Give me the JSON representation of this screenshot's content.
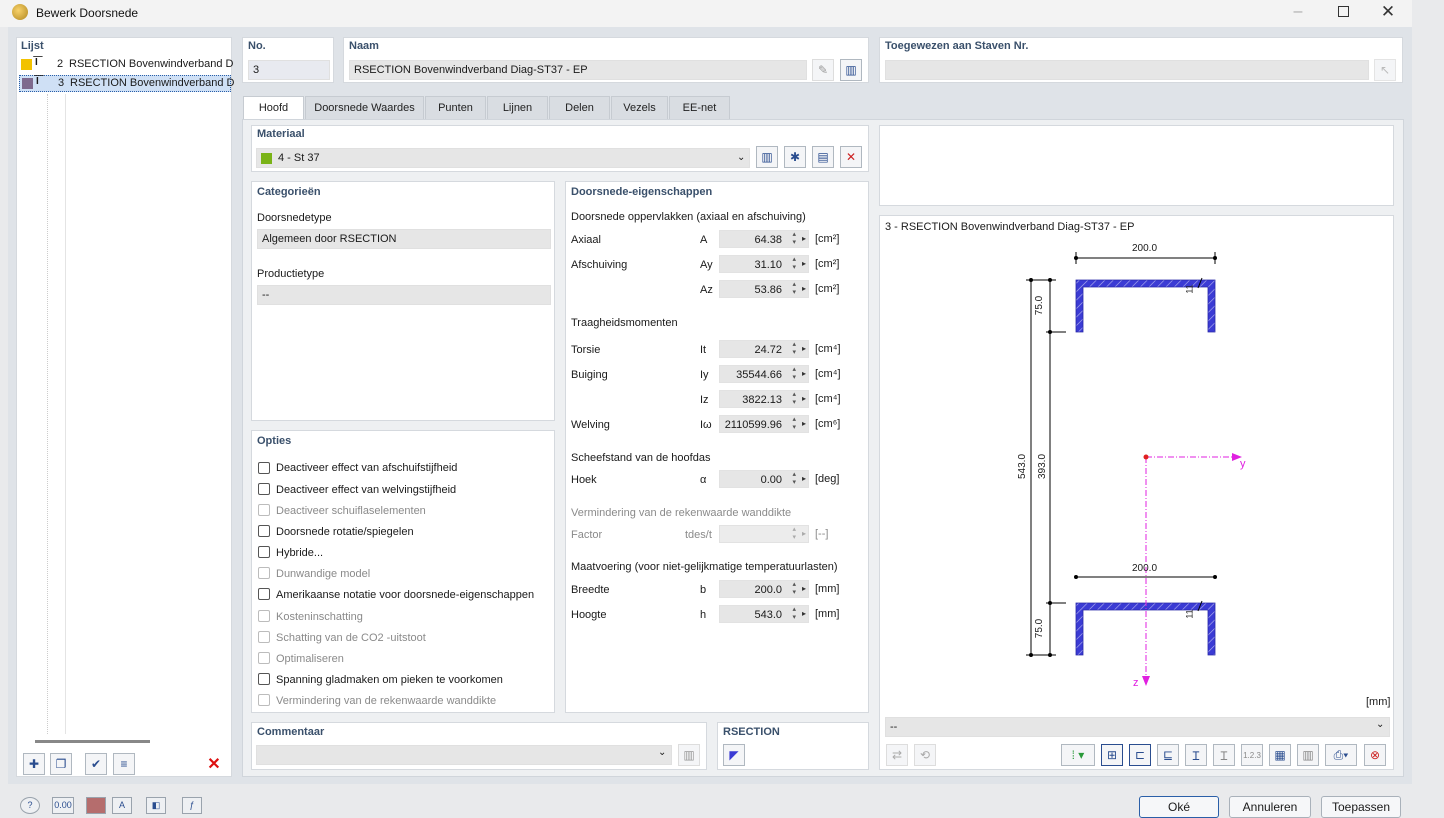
{
  "window": {
    "title": "Bewerk Doorsnede",
    "minimize_icon": "minimize-icon",
    "maximize_icon": "maximize-icon",
    "close_icon": "close-icon"
  },
  "list": {
    "header": "Lijst",
    "items": [
      {
        "no": "2",
        "label": "RSECTION Bovenwindverband D",
        "color": "#f2c200"
      },
      {
        "no": "3",
        "label": "RSECTION Bovenwindverband D",
        "color": "#7e6a8e"
      }
    ]
  },
  "no": {
    "header": "No.",
    "value": "3"
  },
  "naam": {
    "header": "Naam",
    "value": "RSECTION Bovenwindverband Diag-ST37 - EP"
  },
  "toegewezen": {
    "header": "Toegewezen aan Staven Nr.",
    "value": ""
  },
  "tabs": [
    "Hoofd",
    "Doorsnede Waardes",
    "Punten",
    "Lijnen",
    "Delen",
    "Vezels",
    "EE-net"
  ],
  "materiaal": {
    "header": "Materiaal",
    "value": "4 - St 37",
    "color": "#7ab317"
  },
  "categorieen": {
    "header": "Categorieën",
    "type_label": "Doorsnedetype",
    "type_value": "Algemeen door RSECTION",
    "product_label": "Productietype",
    "product_value": "--"
  },
  "opties": {
    "header": "Opties",
    "items": [
      {
        "label": "Deactiveer effect van afschuifstijfheid",
        "enabled": true
      },
      {
        "label": "Deactiveer effect van welvingstijfheid",
        "enabled": true
      },
      {
        "label": "Deactiveer schuiflaselementen",
        "enabled": false
      },
      {
        "label": "Doorsnede rotatie/spiegelen",
        "enabled": true
      },
      {
        "label": "Hybride...",
        "enabled": true
      },
      {
        "label": "Dunwandige model",
        "enabled": false
      },
      {
        "label": "Amerikaanse notatie voor doorsnede-eigenschappen",
        "enabled": true
      },
      {
        "label": "Kosteninschatting",
        "enabled": false
      },
      {
        "label": "Schatting van de CO2 -uitstoot",
        "enabled": false
      },
      {
        "label": "Optimaliseren",
        "enabled": false
      },
      {
        "label": "Spanning gladmaken om pieken te voorkomen",
        "enabled": true
      },
      {
        "label": "Vermindering van de rekenwaarde wanddikte",
        "enabled": false
      }
    ]
  },
  "eigenschappen": {
    "header": "Doorsnede-eigenschappen",
    "areas_title": "Doorsnede oppervlakken (axiaal en afschuiving)",
    "axiaal": {
      "label": "Axiaal",
      "sym": "A",
      "value": "64.38",
      "unit": "[cm²]"
    },
    "afschuiving_y": {
      "label": "Afschuiving",
      "sym": "Ay",
      "value": "31.10",
      "unit": "[cm²]"
    },
    "afschuiving_z": {
      "sym": "Az",
      "value": "53.86",
      "unit": "[cm²]"
    },
    "inertia_title": "Traagheidsmomenten",
    "torsie": {
      "label": "Torsie",
      "sym": "It",
      "value": "24.72",
      "unit": "[cm⁴]"
    },
    "buiging_y": {
      "label": "Buiging",
      "sym": "Iy",
      "value": "35544.66",
      "unit": "[cm⁴]"
    },
    "buiging_z": {
      "sym": "Iz",
      "value": "3822.13",
      "unit": "[cm⁴]"
    },
    "welving": {
      "label": "Welving",
      "sym": "Iω",
      "value": "2110599.96",
      "unit": "[cm⁶]"
    },
    "scheef_title": "Scheefstand van de hoofdas",
    "hoek": {
      "label": "Hoek",
      "sym": "α",
      "value": "0.00",
      "unit": "[deg]"
    },
    "verm_title": "Vermindering van de rekenwaarde wanddikte",
    "factor": {
      "label": "Factor",
      "sym": "tdes/t",
      "value": "",
      "unit": "[--]"
    },
    "maat_title": "Maatvoering (voor niet-gelijkmatige temperatuurlasten)",
    "breedte": {
      "label": "Breedte",
      "sym": "b",
      "value": "200.0",
      "unit": "[mm]"
    },
    "hoogte": {
      "label": "Hoogte",
      "sym": "h",
      "value": "543.0",
      "unit": "[mm]"
    }
  },
  "preview": {
    "title": "3 - RSECTION Bovenwindverband Diag-ST37 - EP",
    "unit": "[mm]",
    "dim_width_top": "200.0",
    "dim_width_bottom": "200.0",
    "dim_total": "543.0",
    "dim_inner": "393.0",
    "dim_flange_top": "75.0",
    "dim_flange_bottom": "75.0",
    "dim_thick_top": "11",
    "dim_thick_bottom": "11",
    "axis_y": "y",
    "axis_z": "z",
    "section_color": "#3b3bd4",
    "select_value": "--"
  },
  "commentaar": {
    "header": "Commentaar",
    "value": ""
  },
  "rsection": {
    "header": "RSECTION"
  },
  "buttons": {
    "ok": "Oké",
    "cancel": "Annuleren",
    "apply": "Toepassen"
  },
  "footer": {
    "zero_label": "0.00"
  }
}
